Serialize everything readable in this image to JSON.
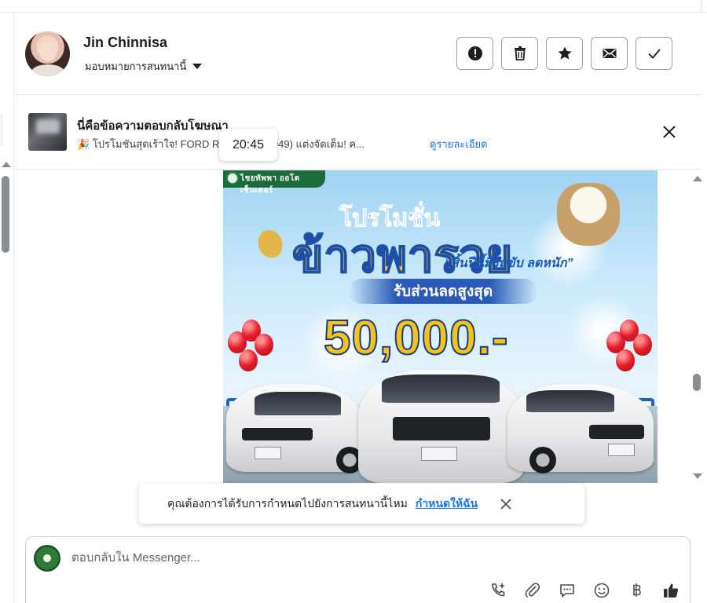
{
  "contact": {
    "name": "Jin Chinnisa",
    "assign_label": "มอบหมายการสนทนานี้"
  },
  "ad": {
    "title": "นี่คือข้อความตอบกลับโฆษณา",
    "description": "🎉 โปรโมชันสุดเร้าใจ! FORD R… ประตู (W049) แต่งจัดเต็ม! ค...",
    "link": "ดูรายละเอียด"
  },
  "timestamp": "20:45",
  "promo_image": {
    "banner": "ไชยทัพพา ออโตเซ็นเตอร์",
    "headline_1": "โปรโมชั่น",
    "headline_2": "ข้าวพารวย",
    "tagline": "“สิ้นปีนี้มีรถขับ ลดหนัก”",
    "discount_label": "รับส่วนลดสูงสุด",
    "amount": "50,000.-"
  },
  "toast": {
    "text": "คุณต้องการได้รับการกำหนดไปยังการสนทนานี้ไหม",
    "link": "กำหนดให้ฉัน"
  },
  "composer": {
    "placeholder": "ตอบกลับใน Messenger..."
  },
  "icons": {
    "header_actions": [
      "alert-icon",
      "trash-icon",
      "star-icon",
      "mail-icon",
      "check-icon"
    ],
    "composer_tools": [
      "call-add-icon",
      "attachment-icon",
      "saved-reply-icon",
      "emoji-icon",
      "baht-icon",
      "thumbs-up-icon"
    ]
  },
  "colors": {
    "link_blue": "#1b74e4",
    "text": "#1c1e21",
    "border": "#e4e6eb"
  }
}
